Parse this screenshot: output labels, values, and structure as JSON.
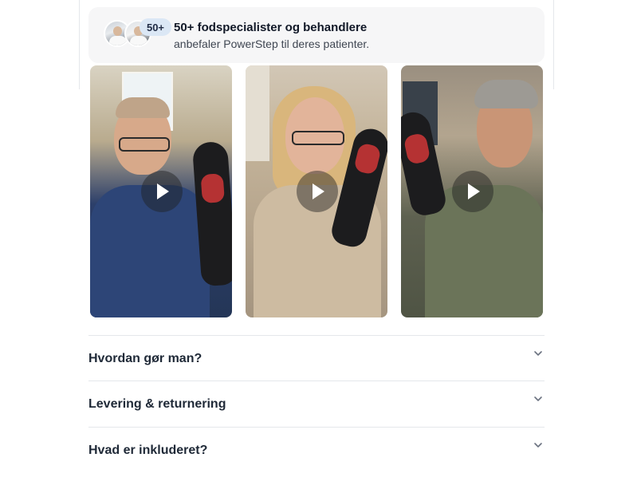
{
  "endorsement": {
    "count_badge": "50+",
    "title": "50+ fodspecialister og behandlere",
    "subtitle": "anbefaler PowerStep til deres patienter."
  },
  "videos": [
    {
      "subject": "man with glasses holding insole",
      "play_icon": "play-icon"
    },
    {
      "subject": "woman with glasses holding insole",
      "play_icon": "play-icon"
    },
    {
      "subject": "man in hoodie holding insole",
      "play_icon": "play-icon"
    }
  ],
  "accordion": [
    {
      "label": "Hvordan gør man?",
      "icon": "chevron-down-icon"
    },
    {
      "label": "Levering & returnering",
      "icon": "chevron-down-icon"
    },
    {
      "label": "Hvad er inkluderet?",
      "icon": "chevron-down-icon"
    }
  ],
  "colors": {
    "card_background": "#f6f6f7",
    "badge_background": "#dbe7f5",
    "insole_heel": "#b53233",
    "divider": "#e5e7eb"
  }
}
